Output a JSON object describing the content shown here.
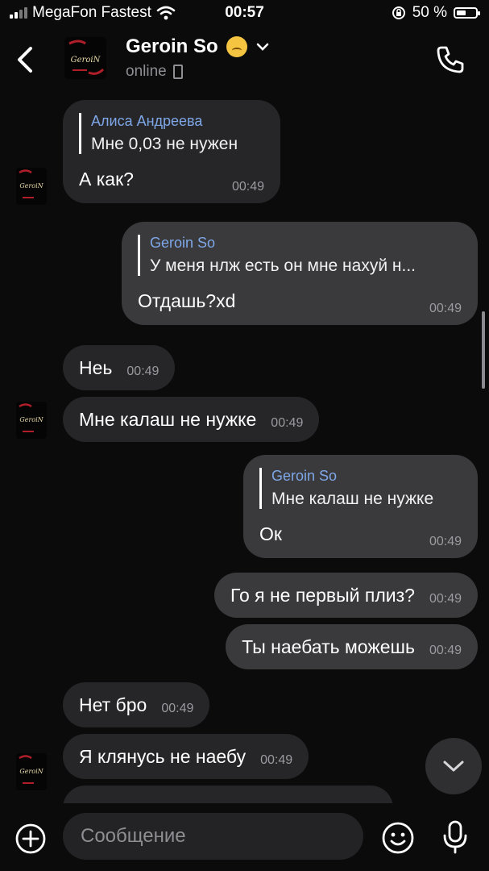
{
  "status_bar": {
    "carrier": "MegaFon Fastest",
    "time": "00:57",
    "battery_percent": "50 %",
    "battery_level": 0.5
  },
  "header": {
    "contact_name": "Geroin So",
    "status": "online",
    "avatar_logo_text": "GeroiN"
  },
  "messages": [
    {
      "dir": "in",
      "reply_name": "Алиса Андреева",
      "reply_text": "Мне 0,03 не нужен",
      "text": "А как?",
      "time": "00:49"
    },
    {
      "dir": "out",
      "reply_name": "Geroin So",
      "reply_text": "У меня нлж есть он мне нахуй н...",
      "text": "Отдашь?xd",
      "time": "00:49"
    },
    {
      "dir": "in",
      "text": "Неь",
      "time": "00:49"
    },
    {
      "dir": "in",
      "text": "Мне калаш не нужке",
      "time": "00:49"
    },
    {
      "dir": "out",
      "reply_name": "Geroin So",
      "reply_text": "Мне калаш не нужке",
      "text": "Ок",
      "time": "00:49"
    },
    {
      "dir": "out",
      "text": "Го я не первый плиз?",
      "time": "00:49"
    },
    {
      "dir": "out",
      "text": "Ты наебать можешь",
      "time": "00:49"
    },
    {
      "dir": "in",
      "text": "Нет бро",
      "time": "00:49"
    },
    {
      "dir": "in",
      "text": "Я клянусь не наебу",
      "time": "00:49"
    }
  ],
  "composer": {
    "placeholder": "Сообщение"
  },
  "icons": {
    "back": "chevron-left-icon",
    "call": "phone-icon",
    "attach": "plus-circle-icon",
    "emoji": "smile-icon",
    "voice": "microphone-icon",
    "scroll_down": "chevron-down-icon"
  }
}
